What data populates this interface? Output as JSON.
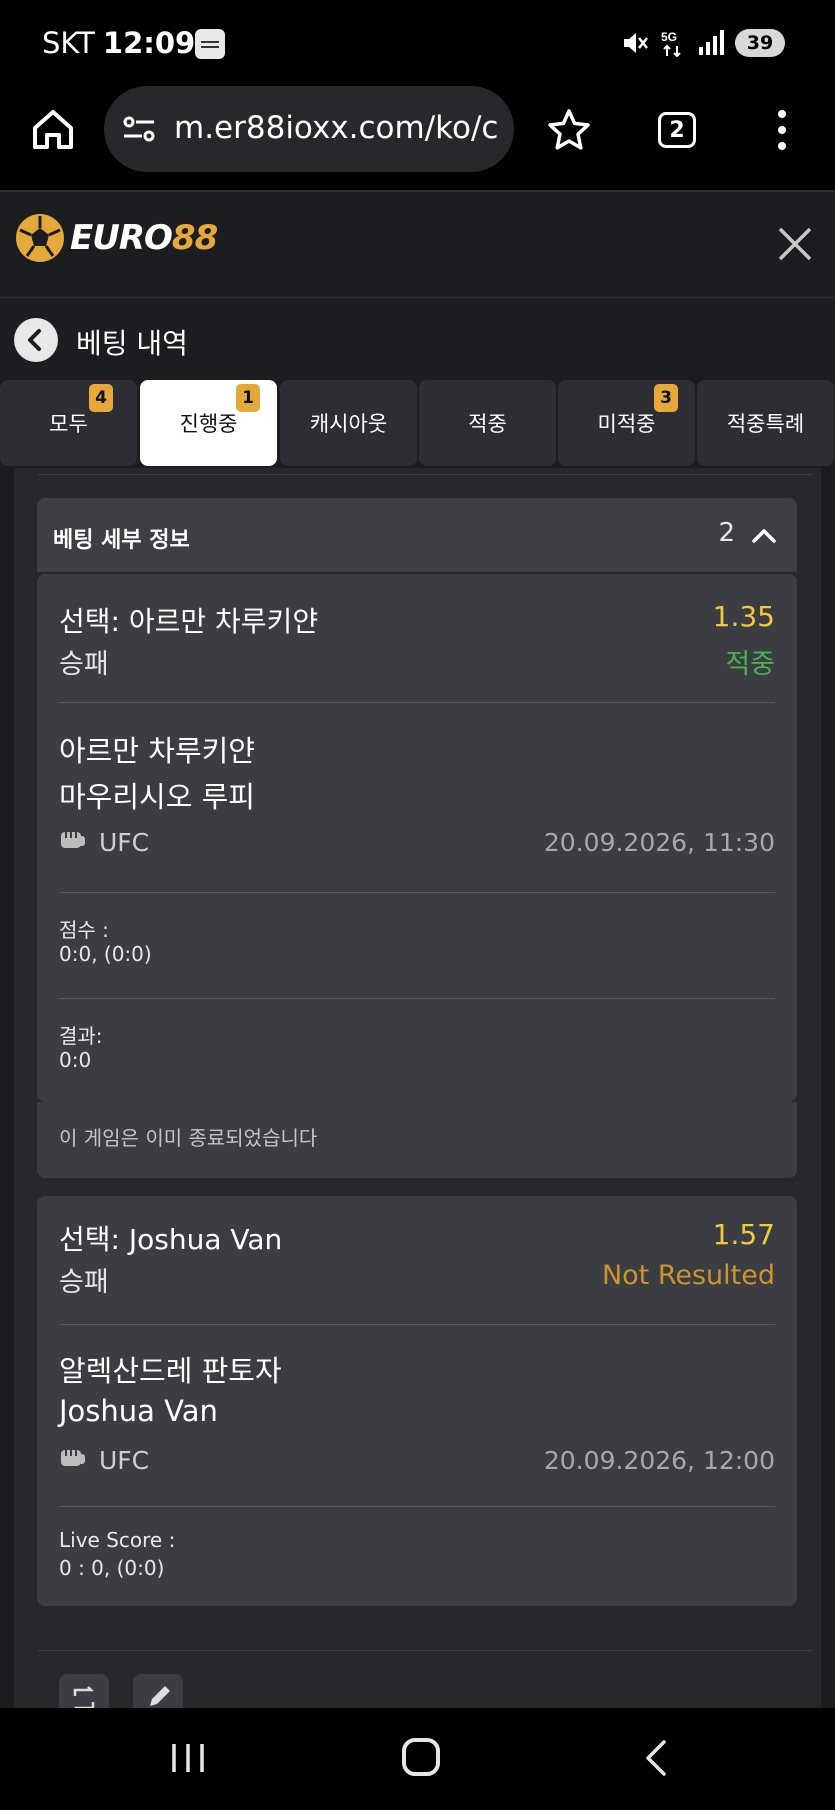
{
  "status_bar": {
    "carrier": "SKT",
    "time": "12:09",
    "battery": "39",
    "network": "5G"
  },
  "browser": {
    "url": "m.er88ioxx.com/ko/c",
    "tab_count": "2"
  },
  "app": {
    "logo_white": "EURO",
    "logo_gold": "88"
  },
  "page": {
    "title": "베팅 내역"
  },
  "tabs": [
    {
      "label": "모두",
      "badge": "4"
    },
    {
      "label": "진행중",
      "badge": "1"
    },
    {
      "label": "캐시아웃",
      "badge": ""
    },
    {
      "label": "적중",
      "badge": ""
    },
    {
      "label": "미적중",
      "badge": "3"
    },
    {
      "label": "적중특례",
      "badge": ""
    }
  ],
  "details": {
    "title": "베팅 세부 정보",
    "count": "2"
  },
  "bets": [
    {
      "selection": "선택: 아르만 차루키얀",
      "market": "승패",
      "odds": "1.35",
      "status": "적중",
      "team1": "아르만 차루키얀",
      "team2": "마우리시오 루피",
      "sport": "UFC",
      "datetime": "20.09.2026, 11:30",
      "score_label": "점수 :",
      "score": "0:0, (0:0)",
      "result_label": "결과:",
      "result": "0:0",
      "note": "이 게임은 이미 종료되었습니다"
    },
    {
      "selection": "선택: Joshua Van",
      "market": "승패",
      "odds": "1.57",
      "status": "Not Resulted",
      "team1": "알렉산드레 판토자",
      "team2": "Joshua Van",
      "sport": "UFC",
      "datetime": "20.09.2026, 12:00",
      "score_label": "Live Score :",
      "score": "0 : 0, (0:0)"
    }
  ]
}
